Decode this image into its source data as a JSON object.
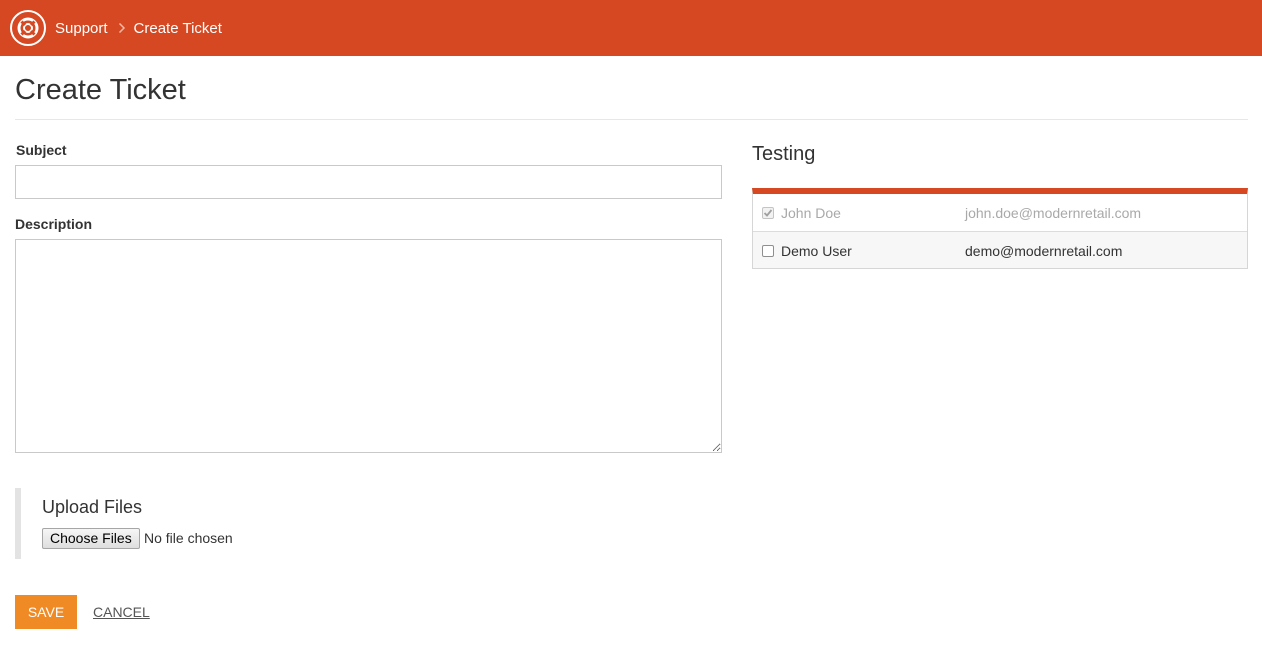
{
  "colors": {
    "brand": "#d54821",
    "accent": "#f08a24"
  },
  "header": {
    "logo_icon": "lifebuoy-icon",
    "breadcrumb": {
      "parent": "Support",
      "separator_icon": "chevron-right-icon",
      "current": "Create Ticket"
    }
  },
  "page": {
    "title": "Create Ticket"
  },
  "form": {
    "subject_label": "Subject",
    "subject_value": "",
    "description_label": "Description",
    "description_value": "",
    "upload": {
      "title": "Upload Files",
      "button_label": "Choose Files",
      "status": "No file chosen"
    },
    "save_label": "Save",
    "cancel_label": "CANCEL"
  },
  "testing": {
    "title": "Testing",
    "users": [
      {
        "name": "John Doe",
        "email": "john.doe@modernretail.com",
        "checked": true,
        "disabled": true
      },
      {
        "name": "Demo User",
        "email": "demo@modernretail.com",
        "checked": false,
        "disabled": false
      }
    ]
  }
}
